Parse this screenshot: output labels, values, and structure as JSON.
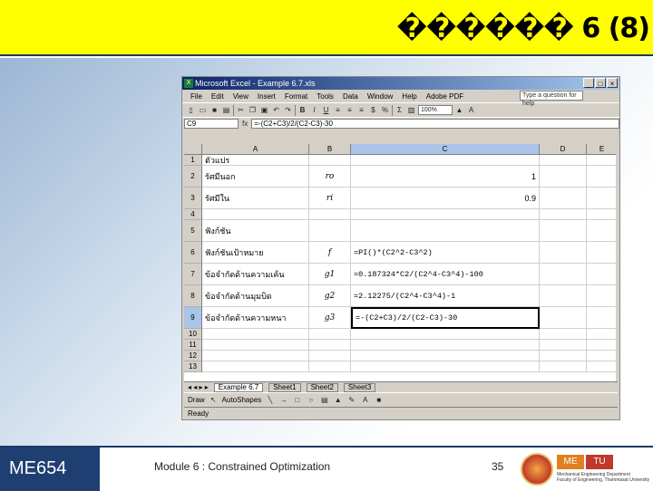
{
  "header": {
    "title": "������ 6 (8)"
  },
  "footer": {
    "course": "ME654",
    "module": "Module 6 : Constrained Optimization",
    "page": "35",
    "badge_me": "ME",
    "badge_tu": "TU",
    "dept_line1": "Mechanical Engineering Department",
    "dept_line2": "Faculty of Engineering, Thammasat University"
  },
  "excel": {
    "title": "Microsoft Excel - Example 6.7.xls",
    "menu": [
      "File",
      "Edit",
      "View",
      "Insert",
      "Format",
      "Tools",
      "Data",
      "Window",
      "Help",
      "Adobe PDF"
    ],
    "help_placeholder": "Type a question for help",
    "zoom": "100%",
    "name_box": "C9",
    "fx": "fx",
    "formula": "=-(C2+C3)/2/(C2-C3)-30",
    "columns": [
      "A",
      "B",
      "C",
      "D",
      "E"
    ],
    "rows": [
      {
        "n": "1",
        "a": "ตัวแปร",
        "b": "",
        "c": ""
      },
      {
        "n": "2",
        "a": "รัศมีนอก",
        "b": "ro",
        "c": "1"
      },
      {
        "n": "3",
        "a": "รัศมีใน",
        "b": "ri",
        "c": "0.9"
      },
      {
        "n": "4",
        "a": "",
        "b": "",
        "c": ""
      },
      {
        "n": "5",
        "a": "ฟังก์ชัน",
        "b": "",
        "c": ""
      },
      {
        "n": "6",
        "a": "ฟังก์ชันเป้าหมาย",
        "b": "f",
        "c": "=PI()*(C2^2-C3^2)"
      },
      {
        "n": "7",
        "a": "ข้อจำกัดด้านความเค้น",
        "b": "g1",
        "c": "=0.187324*C2/(C2^4-C3^4)-100"
      },
      {
        "n": "8",
        "a": "ข้อจำกัดด้านมุมบิด",
        "b": "g2",
        "c": "=2.12275/(C2^4-C3^4)-1"
      },
      {
        "n": "9",
        "a": "ข้อจำกัดด้านความหนา",
        "b": "g3",
        "c": "=-(C2+C3)/2/(C2-C3)-30"
      },
      {
        "n": "10",
        "a": "",
        "b": "",
        "c": ""
      },
      {
        "n": "11",
        "a": "",
        "b": "",
        "c": ""
      },
      {
        "n": "12",
        "a": "",
        "b": "",
        "c": ""
      },
      {
        "n": "13",
        "a": "",
        "b": "",
        "c": ""
      }
    ],
    "tabs": [
      "Example 6.7",
      "Sheet1",
      "Sheet2",
      "Sheet3"
    ],
    "draw_label": "Draw",
    "autoshapes_label": "AutoShapes",
    "status": "Ready"
  },
  "colors": {
    "header_bg": "#ffff00",
    "footer_left": "#1f3f72",
    "title_gradient_start": "#0a246a"
  }
}
